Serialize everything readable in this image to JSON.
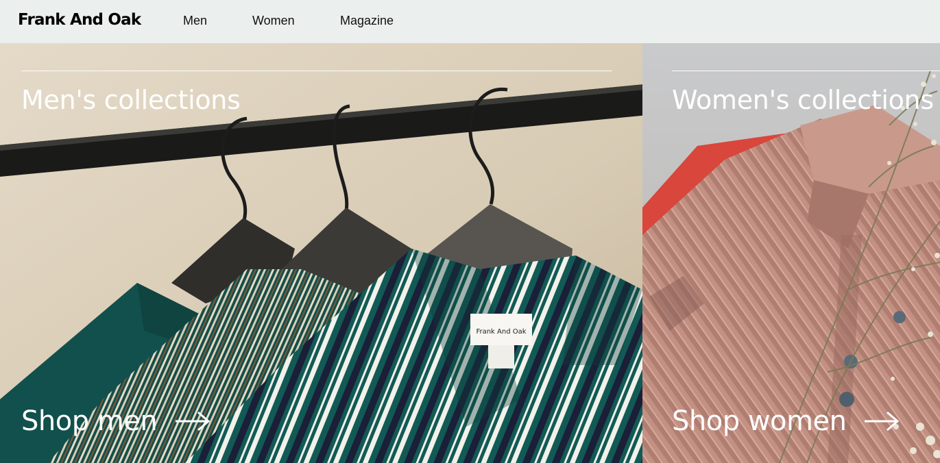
{
  "header": {
    "brand": "Frank And Oak",
    "nav": [
      {
        "label": "Men"
      },
      {
        "label": "Women"
      },
      {
        "label": "Magazine"
      }
    ]
  },
  "panels": [
    {
      "title": "Men's collections",
      "cta": "Shop men",
      "icon": "arrow-right-icon",
      "image": "striped-shirts-on-hangers",
      "tag_text": "Frank And Oak"
    },
    {
      "title": "Women's collections",
      "cta": "Shop women",
      "icon": "arrow-right-icon",
      "image": "pink-ribbed-knit-with-dried-flowers"
    }
  ],
  "colors": {
    "header_bg": "#ebefee",
    "text_on_image": "#ffffff",
    "brand_text": "#000000"
  }
}
